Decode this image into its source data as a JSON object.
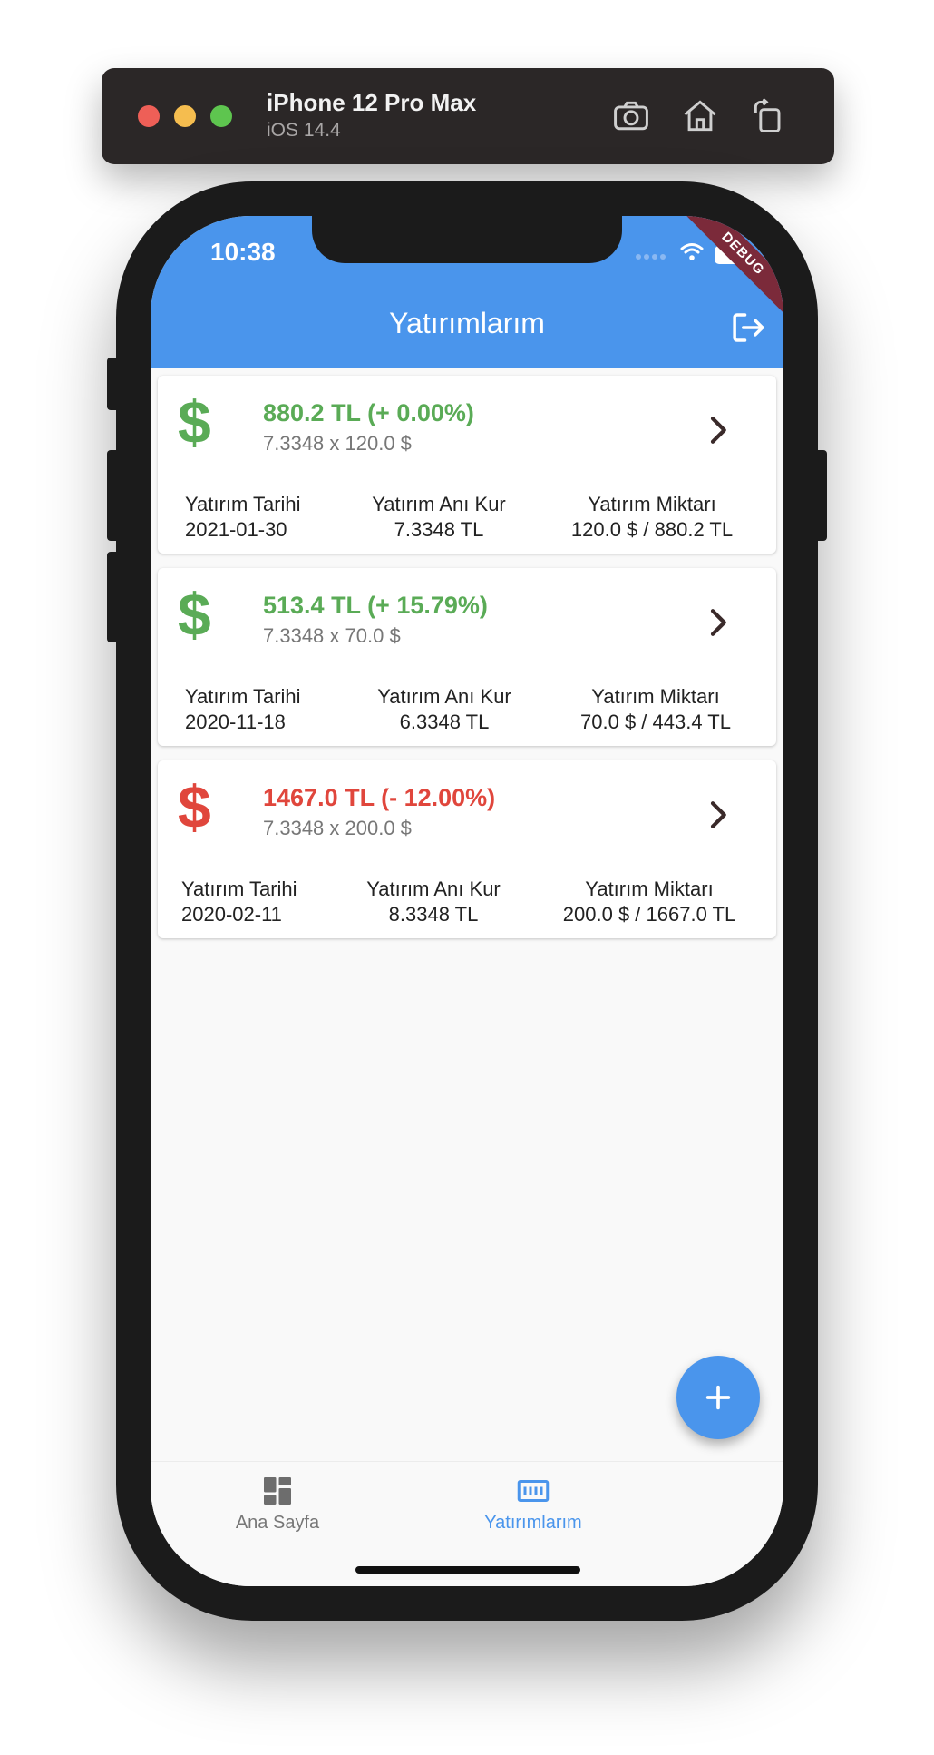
{
  "simulator": {
    "device": "iPhone 12 Pro Max",
    "os": "iOS 14.4"
  },
  "status_bar": {
    "time": "10:38",
    "debug": "DEBUG"
  },
  "appbar": {
    "title": "Yatırımlarım"
  },
  "colors": {
    "primary": "#4a95ec",
    "gain": "#5aab56",
    "loss": "#e0463c"
  },
  "labels": {
    "date": "Yatırım Tarihi",
    "rate": "Yatırım Anı Kur",
    "amount": "Yatırım Miktarı"
  },
  "investments": [
    {
      "amount_text": "880.2 TL (+ 0.00%)",
      "rate_line": "7.3348 x 120.0 $",
      "trend": "gain",
      "date": "2021-01-30",
      "rate": "7.3348 TL",
      "amount": "120.0 $ / 880.2 TL"
    },
    {
      "amount_text": "513.4 TL (+ 15.79%)",
      "rate_line": "7.3348 x 70.0 $",
      "trend": "gain",
      "date": "2020-11-18",
      "rate": "6.3348 TL",
      "amount": "70.0 $ / 443.4 TL"
    },
    {
      "amount_text": "1467.0 TL (- 12.00%)",
      "rate_line": "7.3348 x 200.0 $",
      "trend": "loss",
      "date": "2020-02-11",
      "rate": "8.3348 TL",
      "amount": "200.0 $ / 1667.0 TL"
    }
  ],
  "bottom_nav": {
    "home": "Ana Sayfa",
    "investments": "Yatırımlarım"
  },
  "icons": {
    "dollar": "$"
  }
}
